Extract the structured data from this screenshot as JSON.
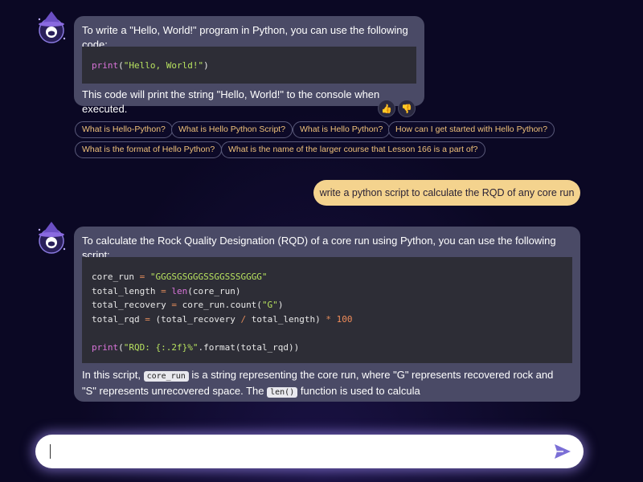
{
  "conversation": {
    "msg1": {
      "intro": "To write a \"Hello, World!\" program in Python, you can use the following code:",
      "code": {
        "fn": "print",
        "open": "(",
        "str": "\"Hello, World!\"",
        "close": ")"
      },
      "outro": "This code will print the string \"Hello, World!\" to the console when executed."
    },
    "reactions": {
      "like": "👍",
      "dislike": "👎"
    },
    "suggestions": [
      "What is Hello-Python?",
      "What is Hello Python Script?",
      "What is Hello Python?",
      "How can I get started with Hello Python?",
      "What is the format of Hello Python?",
      "What is the name of the larger course that Lesson 166 is a part of?"
    ],
    "user_msg": "write a python script to calculate the RQD of any core run",
    "msg2": {
      "intro": "To calculate the Rock Quality Designation (RQD) of a core run using Python, you can use the following script:",
      "code": {
        "l1_var": "core_run",
        "l1_op": " = ",
        "l1_str": "\"GGGSGSGGGSSGGSSSGGGG\"",
        "l2_var": "total_length",
        "l2_op": " = ",
        "l2_fn": "len",
        "l2_rest": "(core_run)",
        "l3_var": "total_recovery",
        "l3_op": " = ",
        "l3_rest": "core_run.count(",
        "l3_str": "\"G\"",
        "l3_close": ")",
        "l4_var": "total_rqd",
        "l4_op": " = ",
        "l4_rest1": "(total_recovery ",
        "l4_div": "/",
        "l4_rest2": " total_length) ",
        "l4_mul": "*",
        "l4_num": " 100",
        "l6_fn": "print",
        "l6_open": "(",
        "l6_str": "\"RQD: {:.2f}%\"",
        "l6_rest": ".format(total_rqd))"
      },
      "outro_1": "In this script, ",
      "inline_1": "core_run",
      "outro_2": " is a string representing the core run, where \"G\" represents recovered rock and \"S\" represents unrecovered space. The ",
      "inline_2": "len()",
      "outro_3": " function is used to calcula"
    }
  },
  "input": {
    "value": ""
  },
  "icons": {
    "avatar": "wizard-hat-github-avatar",
    "send": "paper-plane-send-icon"
  },
  "colors": {
    "background": "#0b0824",
    "bubble": "#4a4a66",
    "code_bg": "#2d2d36",
    "user_bubble": "#f4d38e",
    "chip_text": "#f0c27a",
    "accent": "#7b6fd6"
  }
}
